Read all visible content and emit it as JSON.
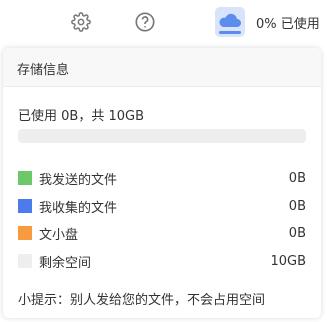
{
  "topbar": {
    "settings_icon": "gear-icon",
    "help_icon": "question-circle-icon",
    "storage_icon": "cloud-icon",
    "storage_label": "0% 已使用"
  },
  "panel": {
    "title": "存储信息",
    "used_summary": "已使用 0B，共 10GB",
    "progress_fraction": 0.0,
    "legend": [
      {
        "label": "我发送的文件",
        "value": "0B",
        "color": "#6cc96b"
      },
      {
        "label": "我收集的文件",
        "value": "0B",
        "color": "#4b7bec"
      },
      {
        "label": "文小盘",
        "value": "0B",
        "color": "#f79b3e"
      },
      {
        "label": "剩余空间",
        "value": "10GB",
        "color": "#eeeeee"
      }
    ],
    "tip": "小提示：别人发给您的文件，不会占用空间"
  }
}
